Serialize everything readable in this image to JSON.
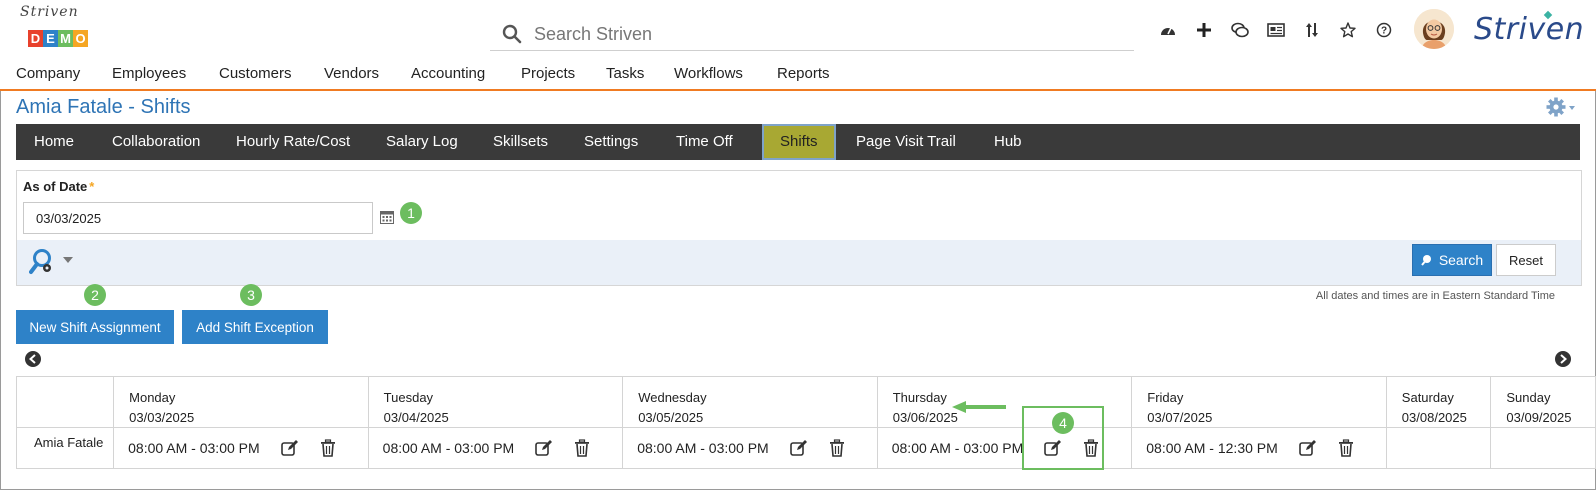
{
  "header": {
    "logo_script": "Striven",
    "logo_demo": [
      "D",
      "E",
      "M",
      "O"
    ],
    "logo_demo_colors": [
      "#e8412c",
      "#2e82c8",
      "#6cbd5f",
      "#f5a623"
    ],
    "search_placeholder": "Search Striven",
    "icons": [
      "dashboard-icon",
      "plus-icon",
      "chat-icon",
      "news-icon",
      "sort-icon",
      "star-icon",
      "help-icon"
    ],
    "brand": "Striven"
  },
  "main_nav": [
    "Company",
    "Employees",
    "Customers",
    "Vendors",
    "Accounting",
    "Projects",
    "Tasks",
    "Workflows",
    "Reports"
  ],
  "page_title": "Amia Fatale - Shifts",
  "tabs": [
    "Home",
    "Collaboration",
    "Hourly Rate/Cost",
    "Salary Log",
    "Skillsets",
    "Settings",
    "Time Off",
    "Shifts",
    "Page Visit Trail",
    "Hub"
  ],
  "active_tab": "Shifts",
  "filter": {
    "label": "As of Date",
    "required_mark": "*",
    "date_value": "03/03/2025",
    "search_label": "Search",
    "reset_label": "Reset"
  },
  "timezone_note": "All dates and times are in Eastern Standard Time",
  "actions": {
    "new_shift": "New Shift Assignment",
    "add_exception": "Add Shift Exception"
  },
  "callouts": [
    "1",
    "2",
    "3",
    "4"
  ],
  "schedule": {
    "employee": "Amia Fatale",
    "days": [
      {
        "day": "Monday",
        "date": "03/03/2025",
        "shift": "08:00 AM - 03:00 PM"
      },
      {
        "day": "Tuesday",
        "date": "03/04/2025",
        "shift": "08:00 AM - 03:00 PM"
      },
      {
        "day": "Wednesday",
        "date": "03/05/2025",
        "shift": "08:00 AM - 03:00 PM"
      },
      {
        "day": "Thursday",
        "date": "03/06/2025",
        "shift": "08:00 AM - 03:00 PM"
      },
      {
        "day": "Friday",
        "date": "03/07/2025",
        "shift": "08:00 AM - 12:30 PM"
      },
      {
        "day": "Saturday",
        "date": "03/08/2025",
        "shift": ""
      },
      {
        "day": "Sunday",
        "date": "03/09/2025",
        "shift": ""
      }
    ]
  },
  "colors": {
    "accent_blue": "#2e82c8",
    "title_blue": "#2e74b5",
    "tab_bar": "#3a3a3a",
    "active_tab": "#a8a833",
    "nav_underline": "#f07b22",
    "callout_green": "#6cbd5f"
  }
}
